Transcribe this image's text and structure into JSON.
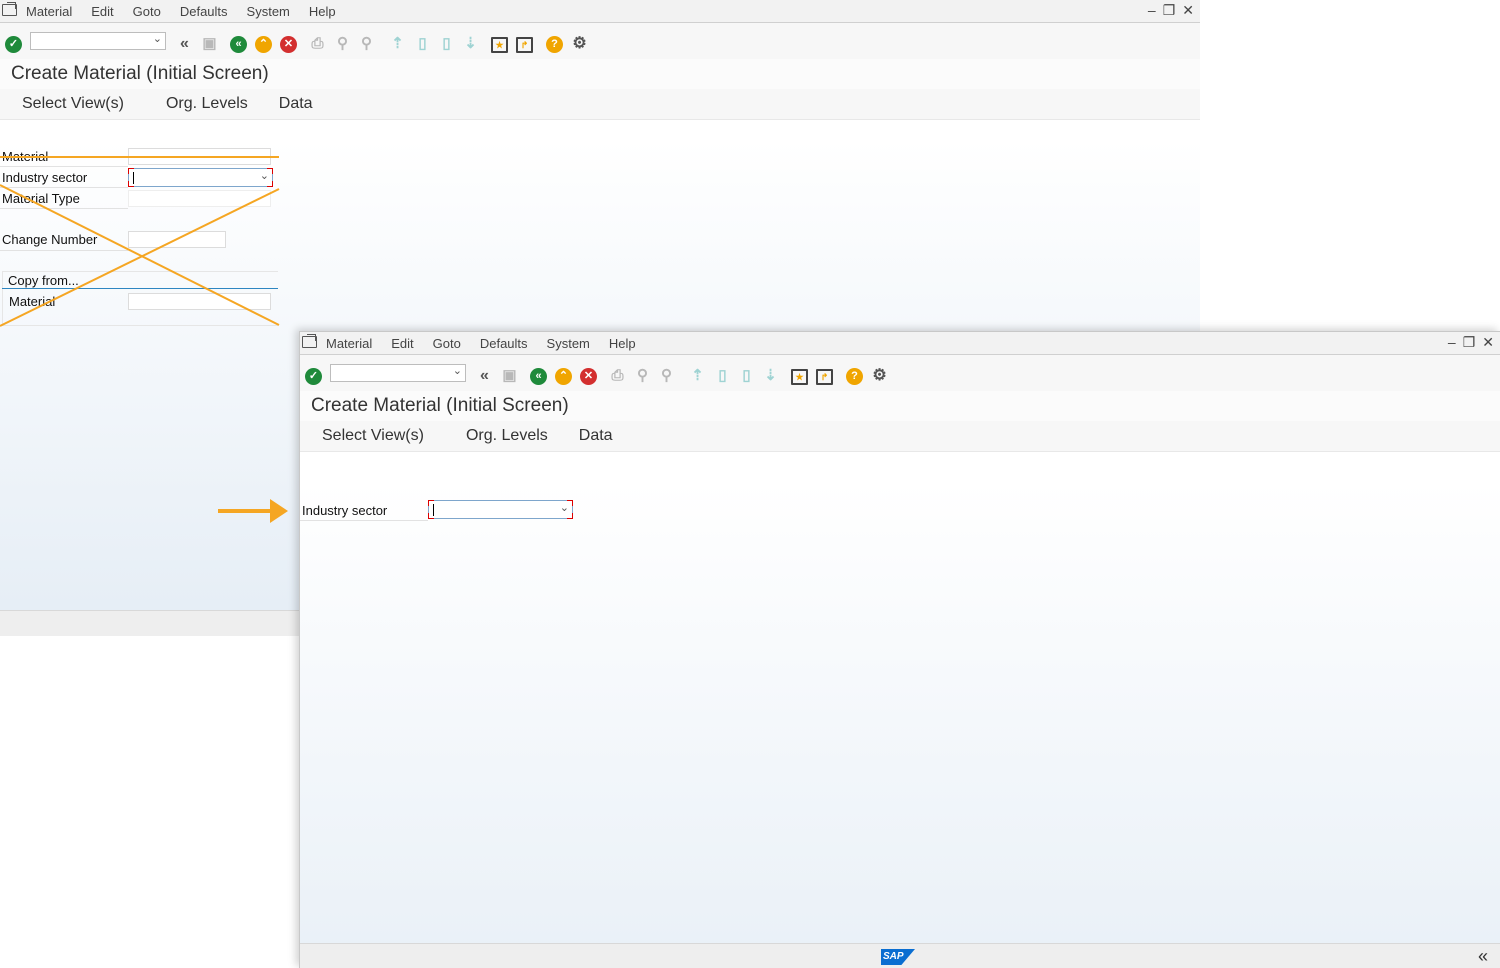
{
  "menu": {
    "items": [
      "Material",
      "Edit",
      "Goto",
      "Defaults",
      "System",
      "Help"
    ]
  },
  "window_controls": {
    "minimize": "–",
    "restore": "❐",
    "close": "✕"
  },
  "toolbar": {
    "command_value": ""
  },
  "screen": {
    "title": "Create Material (Initial Screen)"
  },
  "tabs": [
    "Select View(s)",
    "Org. Levels",
    "Data"
  ],
  "back_form": {
    "material_label": "Material",
    "industry_sector_label": "Industry sector",
    "material_type_label": "Material Type",
    "change_number_label": "Change Number",
    "copy_from_label": "Copy from...",
    "copy_material_label": "Material"
  },
  "front_form": {
    "industry_sector_label": "Industry sector",
    "industry_sector_value": ""
  },
  "status": {
    "logo": "SAP"
  },
  "colors": {
    "accent_annotation": "#f5a623",
    "sap_blue": "#0a6ed1",
    "ok_green": "#1f8a3b",
    "cancel_red": "#d32f2f"
  }
}
